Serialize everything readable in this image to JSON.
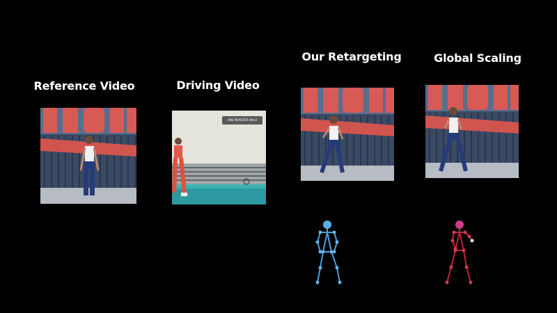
{
  "panels": {
    "reference": {
      "label": "Reference Video"
    },
    "driving": {
      "label": "Driving Video",
      "banner_text": "ONE MONSTER WALK"
    },
    "retarget": {
      "label": "Our Retargeting"
    },
    "global": {
      "label": "Global Scaling"
    }
  },
  "colors": {
    "background": "#000000",
    "label_text": "#ffffff",
    "retarget_skeleton": "#4aa3df",
    "retarget_head": "#5aaee6",
    "global_skeleton": "#c0243c",
    "global_head": "#d03a8a"
  },
  "icons": {
    "retarget_skeleton": "pose-skeleton-icon",
    "global_skeleton": "pose-skeleton-icon"
  }
}
